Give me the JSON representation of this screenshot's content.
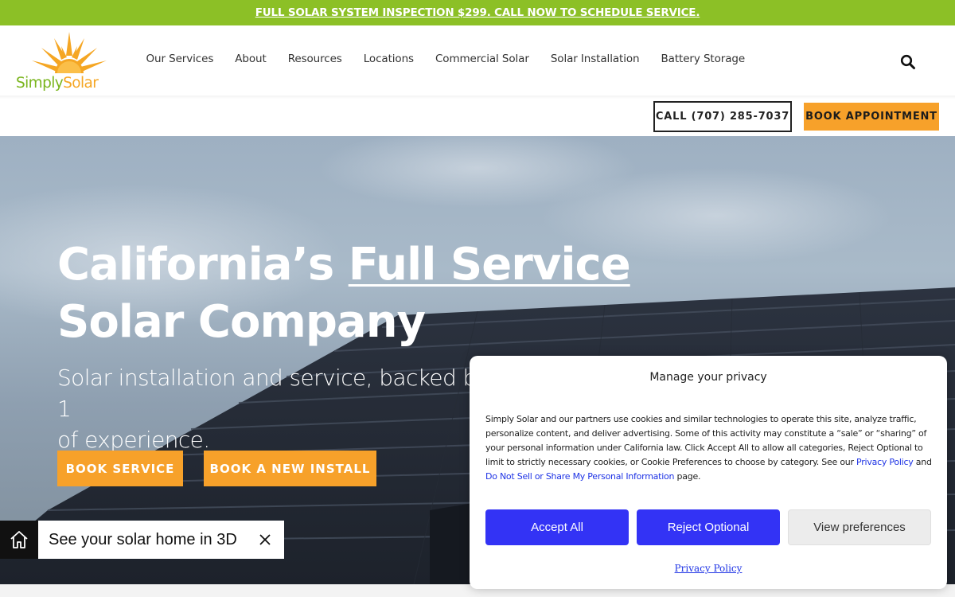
{
  "announcement": {
    "text": "FULL SOLAR SYSTEM INSPECTION $299. CALL NOW TO SCHEDULE SERVICE."
  },
  "logo": {
    "part1": "Simply",
    "part2": "Solar"
  },
  "nav": {
    "items": [
      "Our Services",
      "About",
      "Resources",
      "Locations",
      "Commercial Solar",
      "Solar Installation",
      "Battery Storage"
    ]
  },
  "header": {
    "call_label": "CALL (707) 285-7037",
    "book_label": "BOOK APPOINTMENT"
  },
  "hero": {
    "title_part1": "California’s ",
    "title_underlined": "Full Service",
    "title_part2": "Solar Company",
    "subtitle": "Solar installation and service, backed by 1",
    "subtitle_line2": "of experience.",
    "btn_service": "BOOK SERVICE",
    "btn_install": "BOOK A NEW INSTALL"
  },
  "widget": {
    "text": "See your solar home in 3D"
  },
  "consent": {
    "title": "Manage your privacy",
    "body_text": "Simply Solar and our partners use cookies and similar technologies to operate this site, analyze traffic, personalize content, and deliver advertising. Some of this activity may constitute a “sale” or “sharing” of your personal information under California law. Click Accept All to allow all categories, Reject Optional to limit to strictly necessary cookies, or Cookie Preferences to choose by category. See our ",
    "privacy_link": "Privacy Policy",
    "and_text": " and ",
    "dns_link": "Do Not Sell or Share My Personal Information",
    "page_text": " page.",
    "accept_label": "Accept All",
    "reject_label": "Reject Optional",
    "view_label": "View preferences",
    "footer_link": "Privacy Policy"
  },
  "colors": {
    "green": "#8cc026",
    "orange": "#f7a12a",
    "consent_blue": "#3333f5"
  },
  "icons": {
    "search": "search-icon",
    "home3d": "home-3d-icon",
    "close": "close-icon",
    "sun": "sun-logo-icon"
  }
}
